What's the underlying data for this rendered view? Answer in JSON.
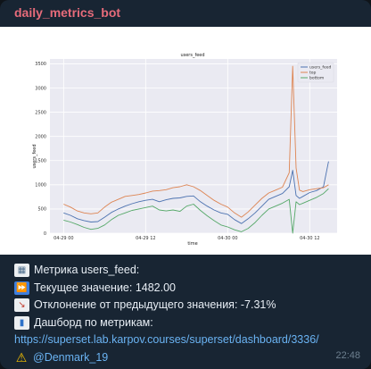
{
  "message": {
    "sender": "daily_metrics_bot",
    "time": "22:48",
    "lines": {
      "metric": "Метрика users_feed:",
      "current": "Текущее значение: 1482.00",
      "deviation": "Отклонение от предыдущего значения: -7.31%",
      "dashboard": "Дашборд по метрикам:",
      "link": "https://superset.lab.karpov.courses/superset/dashboard/3336/",
      "mention": "@Denmark_19"
    },
    "icons": {
      "metric": "chart-emoji-icon",
      "current": "fast-forward-emoji-icon",
      "deviation": "chart-decreasing-emoji-icon",
      "dashboard": "bar-chart-emoji-icon",
      "mention": "warning-emoji-icon"
    },
    "colors": {
      "sender": "#e66b7a",
      "link": "#6ab3f3",
      "bubble": "#182533"
    }
  },
  "chart_data": {
    "type": "line",
    "title": "users_feed",
    "xlabel": "time",
    "ylabel": "users_feed",
    "ylim": [
      0,
      3600
    ],
    "yticks": [
      0,
      500,
      1000,
      1500,
      2000,
      2500,
      3000,
      3500
    ],
    "xtick_labels": [
      "04-29 00",
      "04-29 12",
      "04-30 00",
      "04-30 12"
    ],
    "grid": true,
    "legend_position": "top-right",
    "x_hours": [
      0,
      1,
      2,
      3,
      4,
      5,
      6,
      7,
      8,
      9,
      10,
      11,
      12,
      13,
      14,
      15,
      16,
      17,
      18,
      19,
      20,
      21,
      22,
      23,
      24,
      25,
      26,
      27,
      28,
      29,
      30,
      31,
      32,
      33,
      33.5,
      34,
      34.5,
      35,
      36,
      37,
      38,
      38.75
    ],
    "series": [
      {
        "name": "users_feed",
        "color": "#4c72b0",
        "values": [
          420,
          370,
          300,
          260,
          230,
          240,
          330,
          430,
          500,
          560,
          610,
          650,
          680,
          700,
          650,
          690,
          720,
          730,
          760,
          770,
          650,
          560,
          480,
          420,
          390,
          280,
          200,
          300,
          420,
          560,
          700,
          760,
          820,
          960,
          1300,
          780,
          720,
          760,
          840,
          880,
          960,
          1482
        ]
      },
      {
        "name": "top",
        "color": "#dd8452",
        "values": [
          600,
          540,
          460,
          420,
          400,
          420,
          540,
          640,
          700,
          760,
          780,
          800,
          830,
          870,
          880,
          900,
          940,
          960,
          1000,
          960,
          880,
          780,
          680,
          600,
          540,
          420,
          330,
          440,
          580,
          720,
          830,
          890,
          950,
          1250,
          3450,
          1350,
          890,
          860,
          900,
          920,
          940,
          1000
        ]
      },
      {
        "name": "bottom",
        "color": "#55a868",
        "values": [
          270,
          230,
          180,
          120,
          80,
          100,
          170,
          280,
          370,
          420,
          470,
          500,
          530,
          560,
          480,
          460,
          480,
          450,
          560,
          600,
          470,
          360,
          260,
          170,
          130,
          70,
          30,
          100,
          220,
          370,
          500,
          560,
          620,
          700,
          0,
          650,
          590,
          620,
          680,
          740,
          820,
          920
        ]
      }
    ]
  }
}
